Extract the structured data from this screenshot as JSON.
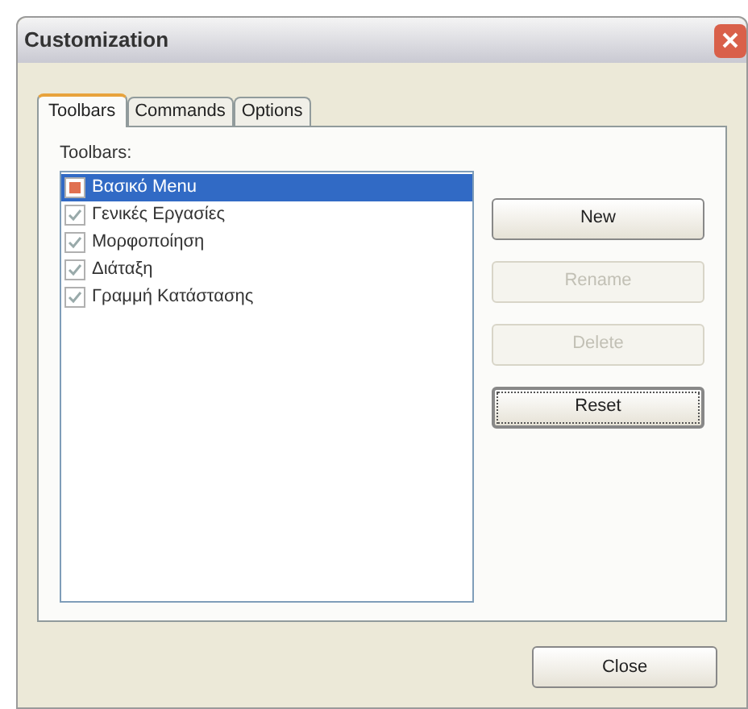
{
  "window": {
    "title": "Customization"
  },
  "tabs": [
    {
      "label": "Toolbars",
      "selected": true
    },
    {
      "label": "Commands",
      "selected": false
    },
    {
      "label": "Options",
      "selected": false
    }
  ],
  "toolbars": {
    "label": "Toolbars:",
    "items": [
      {
        "label": "Βασικό Menu",
        "checked": true,
        "selected": true
      },
      {
        "label": "Γενικές Εργασίες",
        "checked": true,
        "selected": false
      },
      {
        "label": "Μορφοποίηση",
        "checked": true,
        "selected": false
      },
      {
        "label": "Διάταξη",
        "checked": true,
        "selected": false
      },
      {
        "label": "Γραμμή Κατάστασης",
        "checked": true,
        "selected": false
      }
    ]
  },
  "buttons": [
    {
      "label": "New",
      "disabled": false,
      "focused": false
    },
    {
      "label": "Rename",
      "disabled": true,
      "focused": false
    },
    {
      "label": "Delete",
      "disabled": true,
      "focused": false
    },
    {
      "label": "Reset",
      "disabled": false,
      "focused": true
    }
  ],
  "close_button": {
    "label": "Close"
  }
}
